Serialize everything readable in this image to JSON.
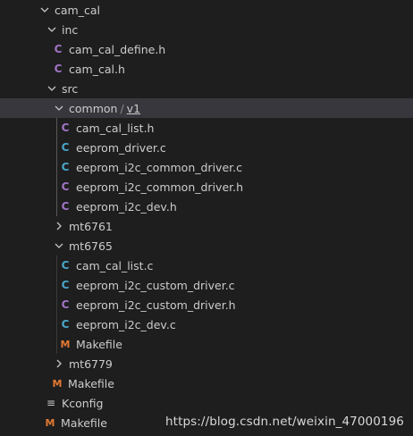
{
  "tree": {
    "root_folder": "cam_cal",
    "inc_folder": "inc",
    "inc_files": [
      "cam_cal_define.h",
      "cam_cal.h"
    ],
    "src_folder": "src",
    "common_folder": "common",
    "common_separator": "/",
    "common_subfolder": "v1",
    "v1_files": [
      "cam_cal_list.h",
      "eeprom_driver.c",
      "eeprom_i2c_common_driver.c",
      "eeprom_i2c_common_driver.h",
      "eeprom_i2c_dev.h"
    ],
    "mt6761_folder": "mt6761",
    "mt6765_folder": "mt6765",
    "mt6765_files": [
      "cam_cal_list.c",
      "eeprom_i2c_custom_driver.c",
      "eeprom_i2c_custom_driver.h",
      "eeprom_i2c_dev.c",
      "Makefile"
    ],
    "mt6779_folder": "mt6779",
    "src_makefile": "Makefile",
    "kconfig": "Kconfig",
    "root_makefile": "Makefile"
  },
  "icons": {
    "c_header_glyph": "C",
    "c_source_glyph": "C",
    "makefile_glyph": "M",
    "kconfig_glyph": "≡"
  },
  "colors": {
    "background": "#1e1e1e",
    "selected_row": "#37373d",
    "header_icon": "#a074c4",
    "source_icon": "#4aa5c8",
    "makefile_icon": "#e37933"
  },
  "watermark": "https://blog.csdn.net/weixin_47000196"
}
